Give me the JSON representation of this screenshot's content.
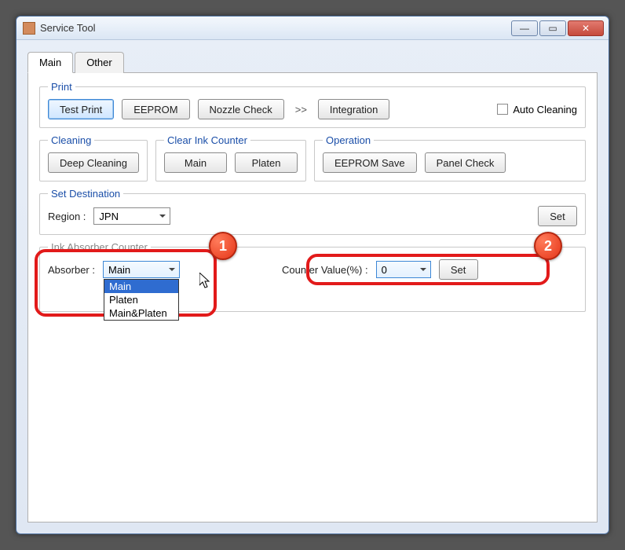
{
  "window": {
    "title": "Service Tool"
  },
  "tabs": {
    "main": "Main",
    "other": "Other"
  },
  "print": {
    "legend": "Print",
    "test_print": "Test Print",
    "eeprom": "EEPROM",
    "nozzle_check": "Nozzle Check",
    "separator": ">>",
    "integration": "Integration",
    "auto_cleaning": "Auto Cleaning"
  },
  "cleaning": {
    "legend": "Cleaning",
    "deep": "Deep Cleaning"
  },
  "clear_ink": {
    "legend": "Clear Ink Counter",
    "main": "Main",
    "platen": "Platen"
  },
  "operation": {
    "legend": "Operation",
    "eeprom_save": "EEPROM Save",
    "panel_check": "Panel Check"
  },
  "set_dest": {
    "legend": "Set Destination",
    "region_label": "Region :",
    "region_value": "JPN",
    "set": "Set"
  },
  "ink_absorber": {
    "legend": "Ink Absorber Counter",
    "absorber_label": "Absorber :",
    "absorber_value": "Main",
    "options": {
      "main": "Main",
      "platen": "Platen",
      "both": "Main&Platen"
    },
    "counter_label": "Counter Value(%) :",
    "counter_value": "0",
    "set": "Set"
  },
  "bubbles": {
    "one": "1",
    "two": "2"
  }
}
